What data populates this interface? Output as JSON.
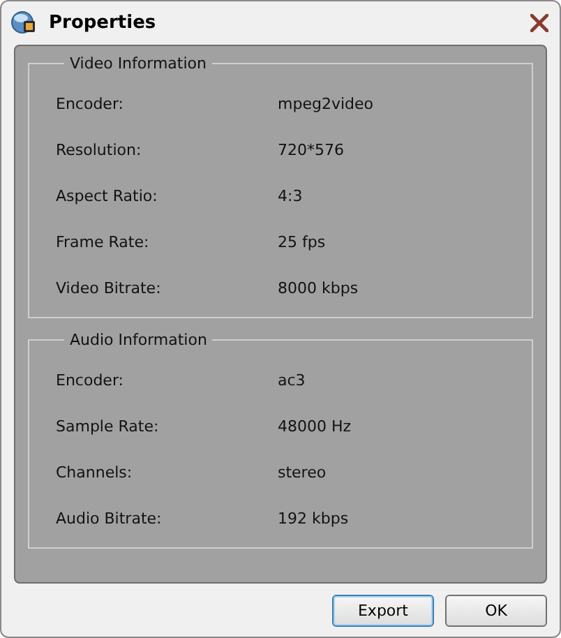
{
  "window": {
    "title": "Properties"
  },
  "groups": [
    {
      "title": "Video Information",
      "rows": [
        {
          "label": "Encoder:",
          "value": "mpeg2video"
        },
        {
          "label": "Resolution:",
          "value": "720*576"
        },
        {
          "label": "Aspect Ratio:",
          "value": "4:3"
        },
        {
          "label": "Frame Rate:",
          "value": "25 fps"
        },
        {
          "label": "Video Bitrate:",
          "value": "8000 kbps"
        }
      ]
    },
    {
      "title": "Audio Information",
      "rows": [
        {
          "label": "Encoder:",
          "value": "ac3"
        },
        {
          "label": "Sample Rate:",
          "value": "48000 Hz"
        },
        {
          "label": "Channels:",
          "value": "stereo"
        },
        {
          "label": "Audio Bitrate:",
          "value": "192 kbps"
        }
      ]
    }
  ],
  "buttons": [
    {
      "label": "Export",
      "focused": true
    },
    {
      "label": "OK",
      "focused": false
    }
  ]
}
